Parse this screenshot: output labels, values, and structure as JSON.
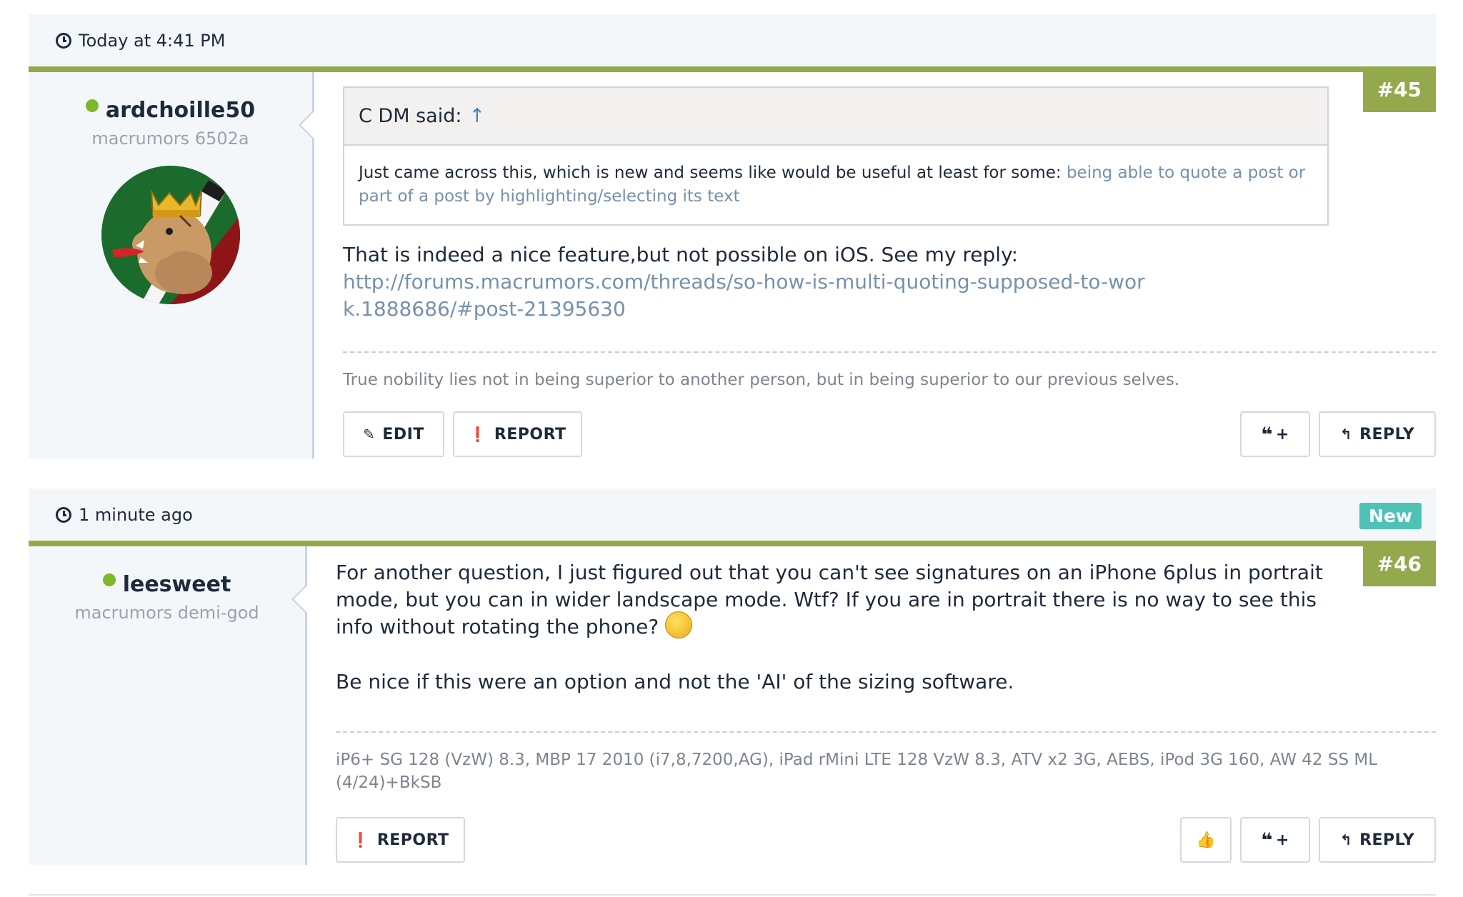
{
  "posts": [
    {
      "timestamp": "Today at 4:41 PM",
      "username": "ardchoille50",
      "user_title": "macrumors 6502a",
      "post_number": "#45",
      "quote": {
        "author_line": "C DM said:",
        "arrow": "↑",
        "text": "Just came across this, which is new and seems like would be useful at least for some: ",
        "link_text": "being able to quote a post or part of a post by highlighting/selecting its text"
      },
      "message_text": "That is indeed a nice feature,but not possible on iOS. See my reply:",
      "message_link": "http://forums.macrumors.com/threads/so-how-is-multi-quoting-supposed-to-work.1888686/#post-21395630",
      "signature": "True nobility lies not in being superior to another person, but in being superior to our previous selves.",
      "buttons": {
        "edit": "EDIT",
        "report": "REPORT",
        "multiquote": "+",
        "reply": "REPLY"
      }
    },
    {
      "timestamp": "1 minute ago",
      "badge": "New",
      "username": "leesweet",
      "user_title": "macrumors demi-god",
      "post_number": "#46",
      "message_p1": "For another question, I just figured out that you can't see signatures on an iPhone 6plus in portrait mode, but you can in wider landscape mode. Wtf? If you are in portrait there is no way to see this info without rotating the phone?",
      "message_p2": "Be nice if this were an option and not the 'AI' of the sizing software.",
      "signature": "iP6+ SG 128 (VzW) 8.3, MBP 17 2010 (i7,8,7200,AG), iPad rMini LTE 128 VzW 8.3, ATV x2 3G, AEBS, iPod 3G 160, AW 42 SS ML (4/24)+BkSB",
      "buttons": {
        "report": "REPORT",
        "multiquote": "+",
        "reply": "REPLY"
      }
    }
  ],
  "icons": [
    "clock-icon",
    "pencil-icon",
    "report-icon",
    "quote-icon",
    "reply-icon",
    "thumbs-up-icon",
    "smiley-icon",
    "online-indicator-icon"
  ],
  "colors": {
    "accent_green": "#94a94c",
    "badge_teal": "#4ec3b5",
    "link": "#7691ad",
    "online": "#7cb928"
  }
}
